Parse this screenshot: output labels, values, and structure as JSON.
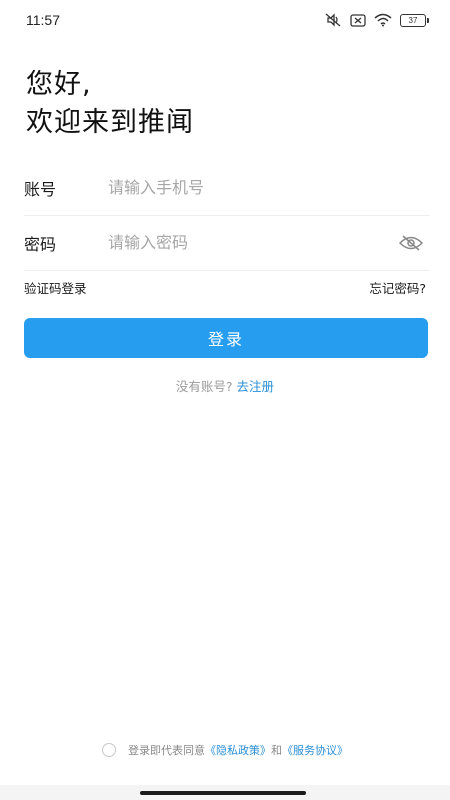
{
  "status_bar": {
    "time": "11:57",
    "battery_level": "37",
    "icons": [
      "mute-icon",
      "sim-off-icon",
      "wifi-icon",
      "battery-icon"
    ]
  },
  "greeting": {
    "line1": "您好,",
    "line2": "欢迎来到推闻"
  },
  "form": {
    "account_label": "账号",
    "account_placeholder": "请输入手机号",
    "password_label": "密码",
    "password_placeholder": "请输入密码"
  },
  "links": {
    "sms_login": "验证码登录",
    "forgot_password": "忘记密码?"
  },
  "login_button": "登录",
  "register": {
    "prompt": "没有账号?",
    "link": "去注册"
  },
  "agreement": {
    "prefix": "登录即代表同意",
    "privacy": "《隐私政策》",
    "and": "和",
    "service": "《服务协议》"
  },
  "colors": {
    "primary": "#279df0",
    "link": "#2a8fd6",
    "placeholder": "#a6a6a6"
  }
}
